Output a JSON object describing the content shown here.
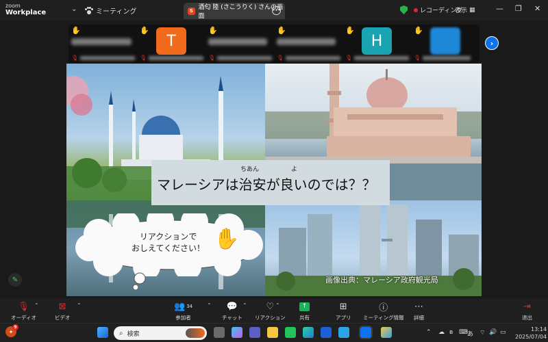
{
  "titlebar": {
    "logo_small": "zoom",
    "logo_big": "Workplace",
    "meeting_label": "ミーティング",
    "tab_initial": "S",
    "tab_title": "酒匂 陸 (さこうりく) さんの画面",
    "recording_label": "レコーディング",
    "view_label": "表示",
    "minimize": "—",
    "restore": "❐",
    "close": "✕"
  },
  "participants": [
    {
      "type": "name",
      "hand": true,
      "avatar_letter": ""
    },
    {
      "type": "avatar",
      "hand": true,
      "avatar_letter": "T",
      "color": "#f26b1d"
    },
    {
      "type": "name",
      "hand": true,
      "avatar_letter": ""
    },
    {
      "type": "name",
      "hand": true,
      "avatar_letter": ""
    },
    {
      "type": "avatar",
      "hand": true,
      "avatar_letter": "H",
      "color": "#1aa3b0"
    },
    {
      "type": "avatar",
      "hand": true,
      "avatar_letter": "",
      "color": "#1e88d8"
    }
  ],
  "slide": {
    "ruby_chian": "ちあん",
    "ruby_yo": "よ",
    "title": "マレーシアは治安が良いのでは？？",
    "bubble_line1": "リアクションで",
    "bubble_line2": "おしえてください！",
    "credit": "画像出典：マレーシア政府観光局"
  },
  "toolbar": {
    "audio": "オーディオ",
    "video": "ビデオ",
    "participants": "参加者",
    "participant_count": "34",
    "chat": "チャット",
    "reactions": "リアクション",
    "share": "共有",
    "apps": "アプリ",
    "meeting_info": "ミーティング情報",
    "more": "詳細",
    "leave": "退出"
  },
  "taskbar": {
    "notification_count": "9",
    "search_placeholder": "検索",
    "ime": "あ",
    "time": "13:14",
    "date": "2025/07/04"
  },
  "colors": {
    "accent": "#0e72ed",
    "share_green": "#19b35a",
    "leave_red": "#e02828"
  }
}
